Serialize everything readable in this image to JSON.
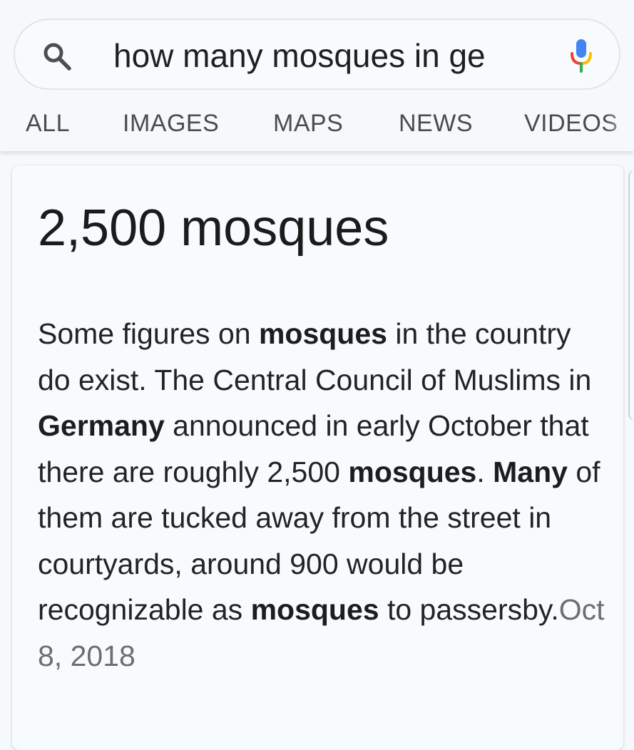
{
  "search": {
    "query": "how many mosques in ge",
    "search_icon": "search-icon",
    "mic_icon": "microphone-icon"
  },
  "tabs": [
    {
      "label": "ALL"
    },
    {
      "label": "IMAGES"
    },
    {
      "label": "MAPS"
    },
    {
      "label": "NEWS"
    },
    {
      "label": "VIDEOS"
    }
  ],
  "answer": {
    "title": "2,500 mosques",
    "snippet": {
      "part1": "Some figures on ",
      "bold1": "mosques",
      "part2": " in the country do exist. The Central Council of Muslims in ",
      "bold2": "Germany",
      "part3": " announced in early October that there are roughly 2,500 ",
      "bold3": "mosques",
      "part4": ". ",
      "bold4": "Many",
      "part5": " of them are tucked away from the street in courtyards, around 900 would be recognizable as ",
      "bold5": "mosques",
      "part6": " to passersby.",
      "date": "Oct 8, 2018"
    }
  },
  "colors": {
    "background": "#f6f9fb",
    "tab_text": "#4a4d50",
    "date_text": "#6b6f73",
    "mic_blue": "#4285f4",
    "mic_red": "#ea4335",
    "mic_yellow": "#fbbc05",
    "mic_green": "#34a853"
  }
}
